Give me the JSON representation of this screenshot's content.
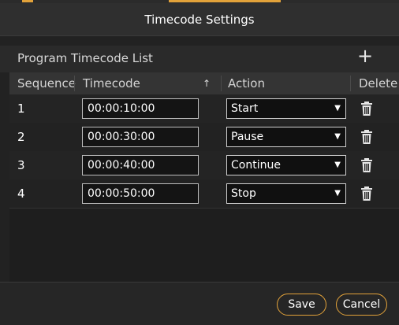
{
  "window": {
    "title": "Timecode Settings"
  },
  "list": {
    "title": "Program Timecode List",
    "add_label": "+"
  },
  "table": {
    "headers": {
      "sequence": "Sequence",
      "timecode": "Timecode",
      "action": "Action",
      "delete": "Delete"
    },
    "sort_indicator": "↑",
    "rows": [
      {
        "sequence": "1",
        "timecode": "00:00:10:00",
        "action": "Start"
      },
      {
        "sequence": "2",
        "timecode": "00:00:30:00",
        "action": "Pause"
      },
      {
        "sequence": "3",
        "timecode": "00:00:40:00",
        "action": "Continue"
      },
      {
        "sequence": "4",
        "timecode": "00:00:50:00",
        "action": "Stop"
      }
    ]
  },
  "footer": {
    "save_label": "Save",
    "cancel_label": "Cancel"
  },
  "colors": {
    "accent": "#e2a23a",
    "background": "#222222"
  }
}
